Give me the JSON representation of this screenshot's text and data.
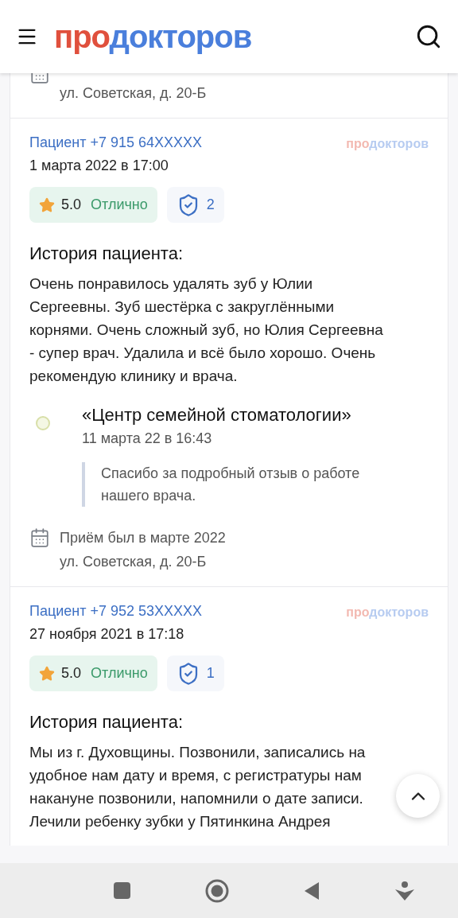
{
  "header": {
    "logo": {
      "first": "про",
      "second": "докторов"
    }
  },
  "partial_card": {
    "address": "ул. Советская, д. 20-Б"
  },
  "reviews": [
    {
      "author": "Пациент +7 915 64XXXXX",
      "date": "1 марта 2022 в 17:00",
      "source": {
        "first": "про",
        "second": "докторов"
      },
      "score": "5.0",
      "verdict": "Отлично",
      "verified": "2",
      "heading": "История пациента:",
      "story": "Очень понравилось удалять зуб у Юлии Сергеевны. Зуб шестёрка с закруглёнными корнями. Очень сложный зуб, но Юлия Сергеевна - супер врач. Удалила и всё было хорошо. Очень рекомендую клинику и врача.",
      "reply": {
        "clinic": "«Центр семейной стоматологии»",
        "date": "11 марта 22 в 16:43",
        "text": "Спасибо за подробный отзыв о работе нашего врача."
      },
      "visit": {
        "when": "Приём был в марте 2022",
        "address": "ул. Советская, д. 20-Б"
      }
    },
    {
      "author": "Пациент +7 952 53XXXXX",
      "date": "27 ноября 2021 в 17:18",
      "source": {
        "first": "про",
        "second": "докторов"
      },
      "score": "5.0",
      "verdict": "Отлично",
      "verified": "1",
      "heading": "История пациента:",
      "story": "Мы из г. Духовщины. Позвонили, записались на удобное нам дату и время, с регистратуры нам накануне позвонили, напомнили о дате записи. Лечили ребенку зубки у Пятинкина Андрея"
    }
  ]
}
